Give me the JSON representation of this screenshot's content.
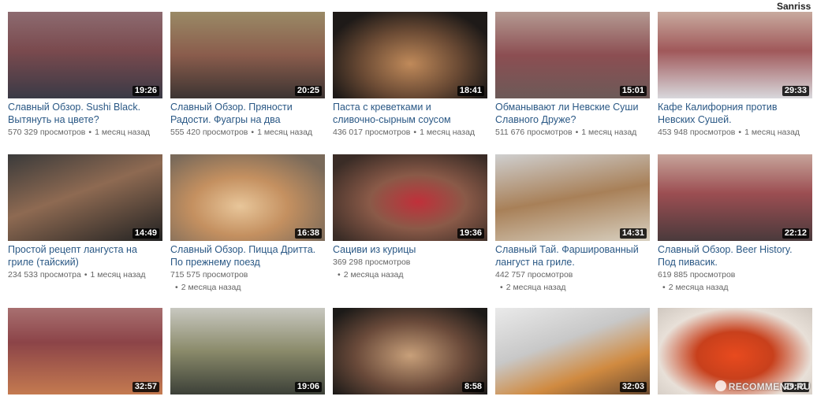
{
  "overlay": {
    "watermark_top": "Sanriss",
    "watermark_bottom": "RECOMMEND.RU"
  },
  "videos": [
    {
      "title": "Славный Обзор. Sushi Black.\nВытянуть на цвете?",
      "views": "570 329 просмотров",
      "age": "1 месяц назад",
      "duration": "19:26"
    },
    {
      "title": "Славный Обзор. Пряности\nРадости. Фуагры на два",
      "views": "555 420 просмотров",
      "age": "1 месяц назад",
      "duration": "20:25"
    },
    {
      "title": "Паста с креветками и\nсливочно-сырным соусом",
      "views": "436 017 просмотров",
      "age": "1 месяц назад",
      "duration": "18:41"
    },
    {
      "title": "Обманывают ли Невские Суши\nСлавного Друже?",
      "views": "511 676 просмотров",
      "age": "1 месяц назад",
      "duration": "15:01"
    },
    {
      "title": "Кафе Калифорния против\nНевских Сушей.",
      "views": "453 948 просмотров",
      "age": "1 месяц назад",
      "duration": "29:33"
    },
    {
      "title": "Простой рецепт лангуста на\nгриле (тайский)",
      "views": "234 533 просмотра",
      "age": "1 месяц назад",
      "duration": "14:49"
    },
    {
      "title": "Славный Обзор. Пицца Дритта.\nПо прежнему поезд",
      "views": "715 575 просмотров",
      "age": "2 месяца назад",
      "duration": "16:38"
    },
    {
      "title": "Сациви из курицы",
      "views": "369 298 просмотров",
      "age": "2 месяца назад",
      "duration": "19:36"
    },
    {
      "title": "Славный Тай. Фаршированный\nлангуст на гриле.",
      "views": "442 757 просмотров",
      "age": "2 месяца назад",
      "duration": "14:31"
    },
    {
      "title": "Славный Обзор. Beer History.\nПод пивасик.",
      "views": "619 885 просмотров",
      "age": "2 месяца назад",
      "duration": "22:12"
    },
    {
      "title": "",
      "views": "",
      "age": "",
      "duration": "32:57"
    },
    {
      "title": "",
      "views": "",
      "age": "",
      "duration": "19:06"
    },
    {
      "title": "",
      "views": "",
      "age": "",
      "duration": "8:58"
    },
    {
      "title": "",
      "views": "",
      "age": "",
      "duration": "32:03"
    },
    {
      "title": "",
      "views": "",
      "age": "",
      "duration": "29:41"
    }
  ],
  "colors": {
    "link": "#2a5885",
    "meta": "#656565",
    "duration_bg": "#000000"
  }
}
